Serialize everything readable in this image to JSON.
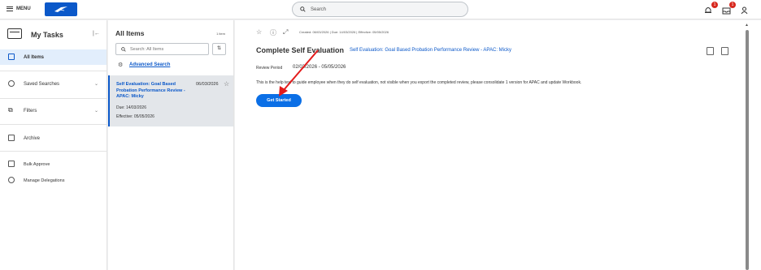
{
  "topbar": {
    "menu_label": "MENU",
    "search_placeholder": "Search",
    "notif_count": "1",
    "inbox_count": "1"
  },
  "left": {
    "title": "My Tasks",
    "items": [
      {
        "label": "All Items"
      },
      {
        "label": "Saved Searches"
      },
      {
        "label": "Filters"
      },
      {
        "label": "Archive"
      },
      {
        "label": "Bulk Approve"
      },
      {
        "label": "Manage Delegations"
      }
    ]
  },
  "mid": {
    "title": "All Items",
    "count": "1 item",
    "search_placeholder": "Search: All Items",
    "advanced_search": "Advanced Search",
    "card": {
      "title": "Self Evaluation: Goal Based Probation Performance Review - APAC: Micky",
      "date": "06/03/2026",
      "due": "Due: 14/03/2026",
      "effective": "Effective: 05/05/2026"
    }
  },
  "detail": {
    "meta": "Created: 06/03/2026 | Due: 14/03/2026 | Effective: 05/05/2026",
    "title": "Complete Self Evaluation",
    "link": "Self Evaluation: Goal Based Probation Performance Review - APAC: Micky",
    "review_period_label": "Review Period",
    "review_period_value": "02/03/2026 - 05/05/2026",
    "help_text": "This is the help text to guide employee when they do self evaluation, not visible when you export the completed review, please consolidate 1 version for APAC and update Workbook.",
    "button": "Get Started"
  },
  "colors": {
    "accent": "#0b58c9",
    "button": "#0b6fe6",
    "annotation_arrow": "#e31b1b",
    "badge": "#d7281e"
  }
}
